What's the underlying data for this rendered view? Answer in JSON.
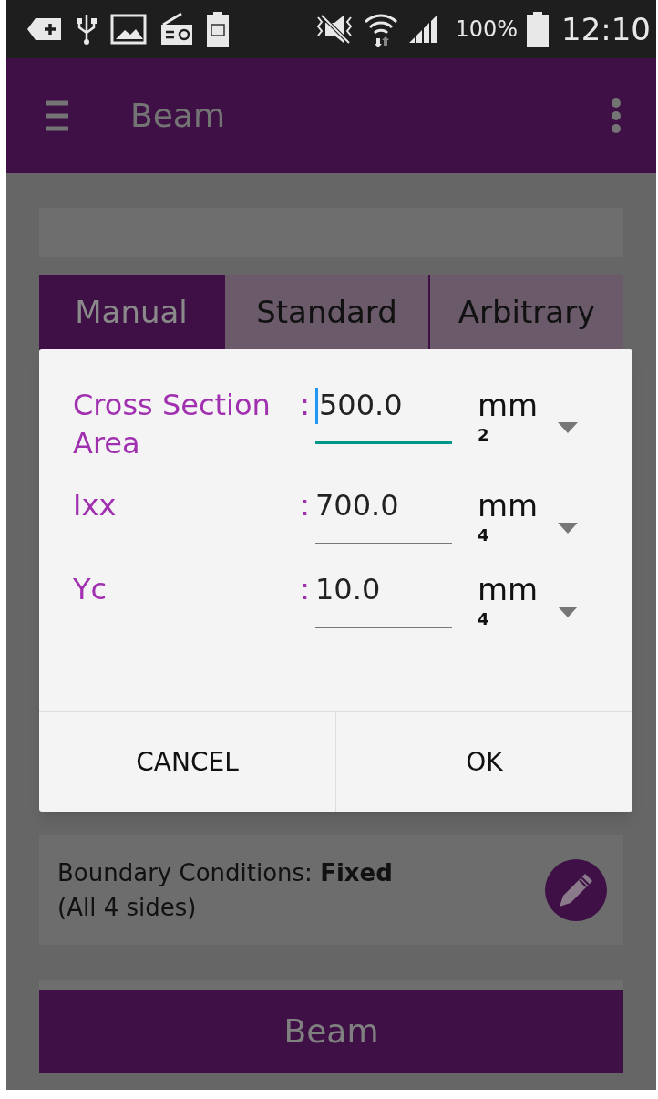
{
  "status_bar": {
    "battery": "100%",
    "time": "12:10"
  },
  "app_bar": {
    "title": "Beam"
  },
  "tabs": [
    {
      "label": "Manual",
      "selected": true
    },
    {
      "label": "Standard",
      "selected": false
    },
    {
      "label": "Arbitrary",
      "selected": false
    }
  ],
  "dialog": {
    "fields": [
      {
        "label": "Cross Section Area",
        "separator": ":",
        "value": "500.0",
        "unit": "mm",
        "exponent": "2",
        "focused": true
      },
      {
        "label": "Ixx",
        "separator": ":",
        "value": "700.0",
        "unit": "mm",
        "exponent": "4",
        "focused": false
      },
      {
        "label": "Yc",
        "separator": ":",
        "value": "10.0",
        "unit": "mm",
        "exponent": "4",
        "focused": false
      }
    ],
    "buttons": [
      "CANCEL",
      "OK"
    ]
  },
  "boundary": {
    "text": "Boundary Conditions: **Fixed** (All 4 sides)"
  },
  "action_button": "Beam"
}
